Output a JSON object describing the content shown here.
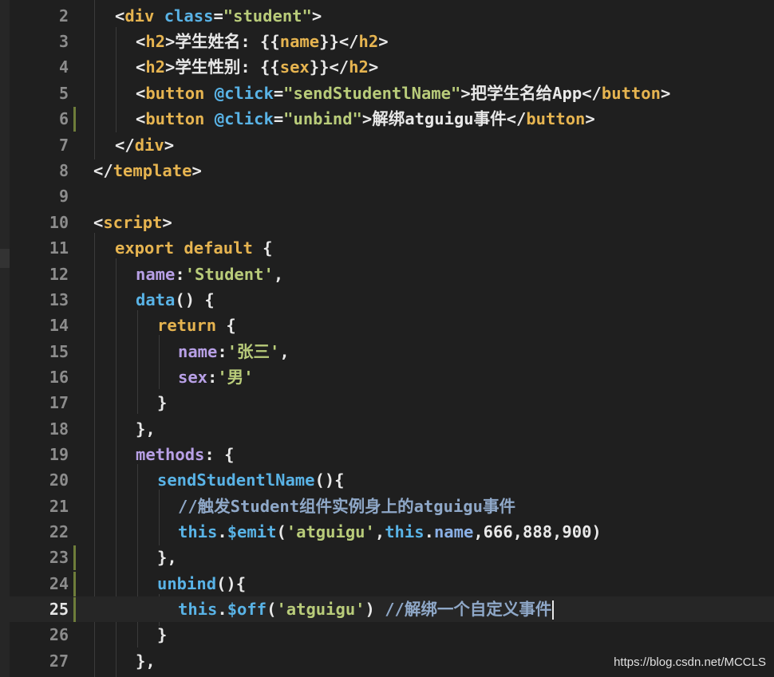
{
  "editor": {
    "watermark": "https://blog.csdn.net/MCCLS",
    "current_line": "25",
    "lines": [
      {
        "n": "2",
        "p": [
          "<",
          "div",
          " ",
          "class",
          "=",
          "\"student\"",
          ">"
        ]
      },
      {
        "n": "3",
        "p": [
          "<",
          "h2",
          ">",
          "学生姓名: {{",
          "name",
          "}}",
          "</",
          "h2",
          ">"
        ]
      },
      {
        "n": "4",
        "p": [
          "<",
          "h2",
          ">",
          "学生性别: {{",
          "sex",
          "}}",
          "</",
          "h2",
          ">"
        ]
      },
      {
        "n": "5",
        "p": [
          "<",
          "button",
          " ",
          "@click",
          "=",
          "\"sendStudentlName\"",
          ">",
          "把学生名给App",
          "</",
          "button",
          ">"
        ]
      },
      {
        "n": "6",
        "p": [
          "<",
          "button",
          " ",
          "@click",
          "=",
          "\"unbind\"",
          ">",
          "解绑atguigu事件",
          "</",
          "button",
          ">"
        ]
      },
      {
        "n": "7",
        "p": [
          "</",
          "div",
          ">"
        ]
      },
      {
        "n": "8",
        "p": [
          "</",
          "template",
          ">"
        ]
      },
      {
        "n": "9",
        "p": []
      },
      {
        "n": "10",
        "p": [
          "<",
          "script",
          ">"
        ]
      },
      {
        "n": "11",
        "p": [
          "export",
          " ",
          "default",
          " {"
        ]
      },
      {
        "n": "12",
        "p": [
          "name",
          ":",
          "'Student'",
          ","
        ]
      },
      {
        "n": "13",
        "p": [
          "data",
          "() {"
        ]
      },
      {
        "n": "14",
        "p": [
          "return",
          " {"
        ]
      },
      {
        "n": "15",
        "p": [
          "name",
          ":",
          "'张三'",
          ","
        ]
      },
      {
        "n": "16",
        "p": [
          "sex",
          ":",
          "'男'"
        ]
      },
      {
        "n": "17",
        "p": [
          "}"
        ]
      },
      {
        "n": "18",
        "p": [
          "},"
        ]
      },
      {
        "n": "19",
        "p": [
          "methods",
          ": {"
        ]
      },
      {
        "n": "20",
        "p": [
          "sendStudentlName",
          "(){"
        ]
      },
      {
        "n": "21",
        "p": [
          "//触发Student组件实例身上的atguigu事件"
        ]
      },
      {
        "n": "22",
        "p": [
          "this",
          ".",
          "$emit",
          "(",
          "'atguigu'",
          ",",
          "this",
          ".",
          "name",
          ",666,888,900)"
        ]
      },
      {
        "n": "23",
        "p": [
          "},"
        ]
      },
      {
        "n": "24",
        "p": [
          "unbind",
          "(){"
        ]
      },
      {
        "n": "25",
        "p": [
          "this",
          ".",
          "$off",
          "(",
          "'atguigu'",
          ") ",
          "//解绑一个自定义事件"
        ]
      },
      {
        "n": "26",
        "p": [
          "}"
        ]
      },
      {
        "n": "27",
        "p": [
          "},"
        ]
      }
    ]
  }
}
